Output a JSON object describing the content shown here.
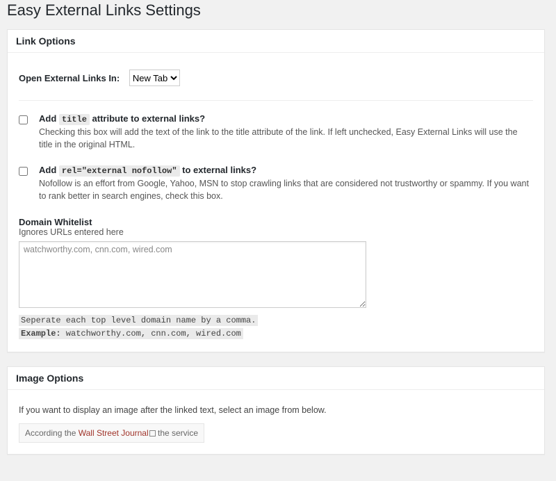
{
  "page": {
    "title": "Easy External Links Settings"
  },
  "link_options": {
    "heading": "Link Options",
    "open_in": {
      "label": "Open External Links In:",
      "selected": "New Tab"
    },
    "title_attr": {
      "title_prefix": "Add ",
      "code": "title",
      "title_suffix": " attribute to external links?",
      "desc": "Checking this box will add the text of the link to the title attribute of the link. If left unchecked, Easy External Links will use the title in the original HTML."
    },
    "rel_attr": {
      "title_prefix": "Add ",
      "code": "rel=\"external nofollow\"",
      "title_suffix": " to external links?",
      "desc": "Nofollow is an effort from Google, Yahoo, MSN to stop crawling links that are considered not trustworthy or spammy. If you want to rank better in search engines, check this box."
    },
    "whitelist": {
      "label": "Domain Whitelist",
      "sub": "Ignores URLs entered here",
      "value": "watchworthy.com, cnn.com, wired.com",
      "note1": "Seperate each top level domain name by a comma.",
      "note2_label": "Example:",
      "note2_value": " watchworthy.com, cnn.com, wired.com"
    }
  },
  "image_options": {
    "heading": "Image Options",
    "intro": "If you want to display an image after the linked text, select an image from below.",
    "preview_prefix": "According the ",
    "preview_link": "Wall Street Journal",
    "preview_suffix": " the service"
  }
}
